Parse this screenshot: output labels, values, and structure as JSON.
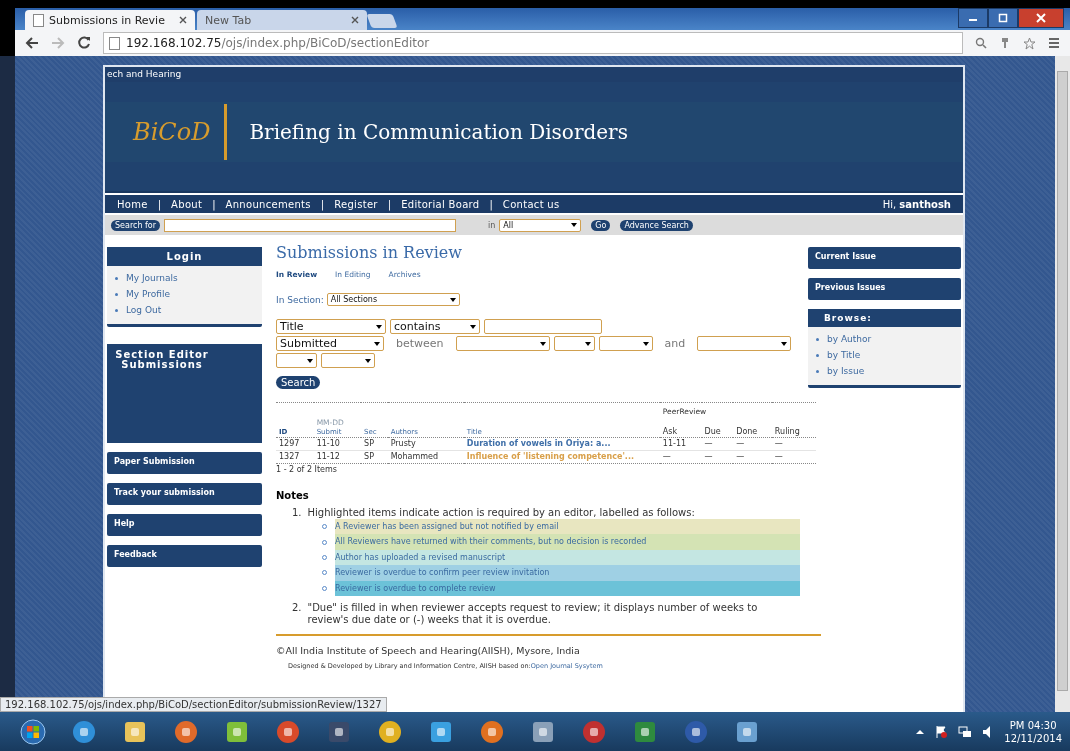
{
  "browser": {
    "tabs": [
      {
        "title": "Submissions in Revie",
        "selected": true
      },
      {
        "title": "New Tab",
        "selected": false
      }
    ],
    "address": {
      "host": "192.168.102.75",
      "path": "/ojs/index.php/BiCoD/sectionEditor"
    },
    "status_url": "192.168.102.75/ojs/index.php/BiCoD/sectionEditor/submissionReview/1327"
  },
  "header": {
    "top_text": "ech and Hearing",
    "logo": "BiCoD",
    "title": "Briefing in Communication Disorders"
  },
  "nav": {
    "items": [
      "Home",
      "About",
      "Announcements",
      "Register",
      "Editorial Board",
      "Contact us"
    ],
    "separator": "|",
    "greeting": "Hi, **santhosh**"
  },
  "search": {
    "label": "Search for",
    "in_label": "in",
    "scope": "All",
    "go": "Go",
    "advanced": "Advance Search"
  },
  "left_sidebar": {
    "login": {
      "title": "Login",
      "items": [
        "My Journals",
        "My Profile",
        "Log Out"
      ]
    },
    "section_editor": {
      "title": "Section Editor Submissions"
    },
    "blocks": [
      "Paper Submission",
      "Track your submission",
      "Help",
      "Feedback"
    ]
  },
  "main": {
    "title": "Submissions in Review",
    "tabs": [
      {
        "label": "In Review",
        "selected": true
      },
      {
        "label": "In Editing",
        "selected": false
      },
      {
        "label": "Archives",
        "selected": false
      }
    ],
    "section_filter": {
      "label": "In Section:",
      "value": "All Sections"
    },
    "filter_row1": {
      "field": "Title",
      "match": "contains"
    },
    "filter_row2": {
      "field": "Submitted",
      "between": "between",
      "and": "and"
    },
    "search_button": "Search",
    "table": {
      "group_label": "PeerReview",
      "columns": [
        {
          "label": "ID"
        },
        {
          "label": "Submit",
          "top": "MM-DD"
        },
        {
          "label": "Sec"
        },
        {
          "label": "Authors"
        },
        {
          "label": "Title"
        },
        {
          "label": "Ask"
        },
        {
          "label": "Due"
        },
        {
          "label": "Done"
        },
        {
          "label": "Ruling"
        }
      ],
      "rows": [
        {
          "id": "1297",
          "submit": "11-10",
          "sec": "SP",
          "authors": "Prusty",
          "title": "Duration of vowels in Oriya: a...",
          "color": "#3f6fa8",
          "ask": "11-11",
          "due": "—",
          "done": "—",
          "ruling": "—"
        },
        {
          "id": "1327",
          "submit": "11-12",
          "sec": "SP",
          "authors": "Mohammed",
          "title": "Influence of 'listening competence'...",
          "color": "#d9a04a",
          "ask": "—",
          "due": "—",
          "done": "—",
          "ruling": "—"
        }
      ],
      "footer": "1 - 2 of 2 Items"
    }
  },
  "notes": {
    "title": "Notes",
    "items": [
      {
        "number": "1.",
        "text": "Highlighted items indicate action is required by an editor, labelled as follows:",
        "legend": [
          {
            "text": "A Reviewer has been assigned but not notified by email",
            "color": "#e8e6c0"
          },
          {
            "text": "All Reviewers have returned with their comments, but no decision is recorded",
            "color": "#d4e3b4"
          },
          {
            "text": "Author has uploaded a revised manuscript",
            "color": "#c4e6e2"
          },
          {
            "text": "Reviewer is overdue to confirm peer review invitation",
            "color": "#9fd0e4"
          },
          {
            "text": "Reviewer is overdue to complete review",
            "color": "#6cc2d8"
          }
        ]
      },
      {
        "number": "2.",
        "text": "\"Due\" is filled in when reviewer accepts request to review; it displays number of weeks to review's due date or (-) weeks that it is overdue."
      }
    ]
  },
  "footer": {
    "copyright": "©All India Institute of Speech and Hearing(AIISH), Mysore, India",
    "credit": "Designed & Developed by Library and Information Centre, AIISH based on:",
    "credit_link": "Open Journal Sysytem"
  },
  "right_sidebar": {
    "blocks": [
      "Current Issue",
      "Previous Issues"
    ],
    "browse": {
      "title": "Browse:",
      "items": [
        "by Author",
        "by Title",
        "by Issue"
      ]
    }
  },
  "clock": {
    "time": "PM 04:30",
    "date": "12/11/2014"
  }
}
